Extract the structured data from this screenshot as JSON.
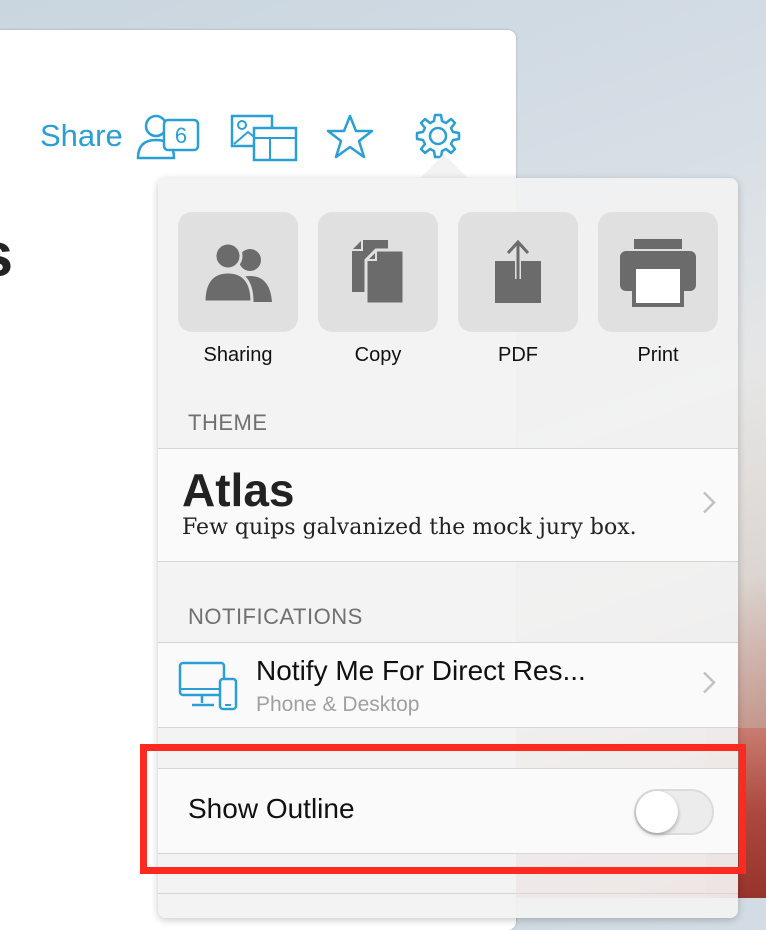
{
  "toolbar": {
    "share_label": "Share",
    "collaborator_count": "6",
    "icons": [
      "collaborators-icon",
      "gallery-icon",
      "star-icon",
      "gear-icon"
    ]
  },
  "document": {
    "heading_fragment": "ts"
  },
  "popover": {
    "actions": [
      {
        "label": "Sharing",
        "icon": "sharing-icon"
      },
      {
        "label": "Copy",
        "icon": "copy-icon"
      },
      {
        "label": "PDF",
        "icon": "pdf-export-icon"
      },
      {
        "label": "Print",
        "icon": "printer-icon"
      }
    ],
    "theme": {
      "header": "THEME",
      "name": "Atlas",
      "sample": "Few quips galvanized the mock jury box."
    },
    "notifications": {
      "header": "NOTIFICATIONS",
      "title": "Notify Me For Direct Res...",
      "subtitle": "Phone & Desktop"
    },
    "outline": {
      "label": "Show Outline",
      "enabled": false
    }
  },
  "colors": {
    "accent": "#2a9fd6",
    "highlight": "#ff2a1f",
    "icon_gray": "#6b6b6b"
  }
}
